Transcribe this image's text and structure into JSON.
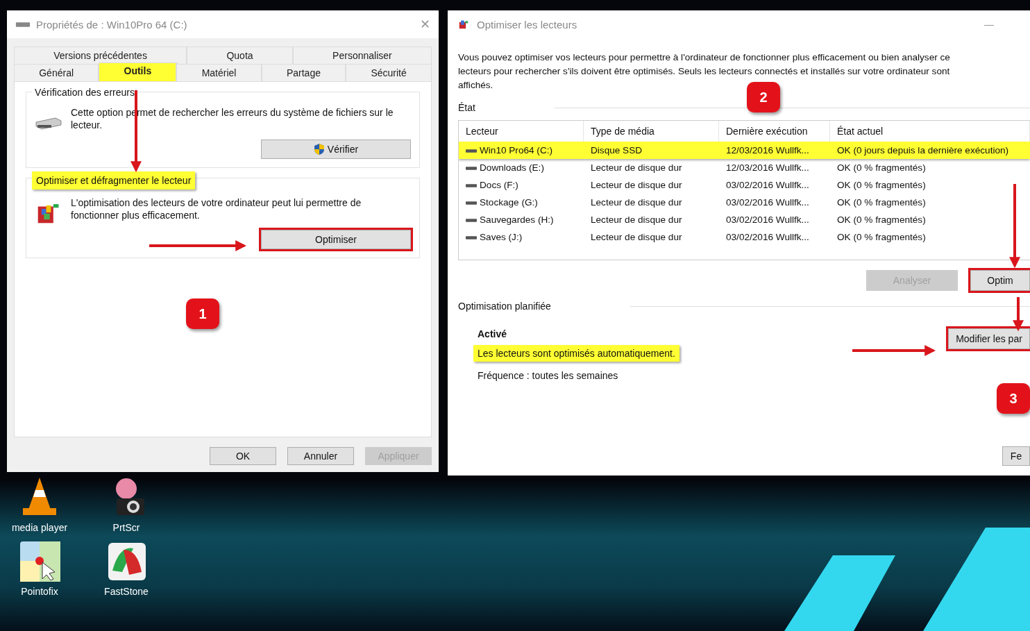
{
  "properties_window": {
    "title": "Propriétés de : Win10Pro 64 (C:)",
    "close": "✕",
    "tab_rows": [
      [
        {
          "label": "Versions précédentes",
          "selected": false,
          "highlighted": false
        },
        {
          "label": "Quota",
          "selected": false,
          "highlighted": false
        },
        {
          "label": "Personnaliser",
          "selected": false,
          "highlighted": false
        }
      ],
      [
        {
          "label": "Général",
          "selected": false,
          "highlighted": false
        },
        {
          "label": "Outils",
          "selected": true,
          "highlighted": true
        },
        {
          "label": "Matériel",
          "selected": false,
          "highlighted": false
        },
        {
          "label": "Partage",
          "selected": false,
          "highlighted": false
        },
        {
          "label": "Sécurité",
          "selected": false,
          "highlighted": false
        }
      ]
    ],
    "groups": [
      {
        "kind": "check",
        "title": "Vérification des erreurs",
        "highlighted": false,
        "text": "Cette option permet de rechercher les erreurs du système de fichiers sur le lecteur.",
        "button": {
          "label": "Vérifier",
          "boxed": false
        }
      },
      {
        "kind": "optimize",
        "title": "Optimiser et défragmenter le lecteur",
        "highlighted": true,
        "text": "L'optimisation des lecteurs de votre ordinateur peut lui permettre de fonctionner plus efficacement.",
        "button": {
          "label": "Optimiser",
          "boxed": true
        }
      }
    ],
    "buttons": [
      {
        "label": "OK",
        "disabled": false
      },
      {
        "label": "Annuler",
        "disabled": false
      },
      {
        "label": "Appliquer",
        "disabled": true
      }
    ]
  },
  "optimize_window": {
    "title": "Optimiser les lecteurs",
    "minimize": "—",
    "intro_lines": [
      "Vous pouvez optimiser vos lecteurs pour permettre à l'ordinateur de fonctionner plus efficacement ou bien analyser ce",
      "lecteurs pour rechercher s'ils doivent être optimisés. Seuls les lecteurs connectés et installés sur votre ordinateur sont",
      "affichés."
    ],
    "status_heading": "État",
    "table": {
      "columns": [
        "Lecteur",
        "Type de média",
        "Dernière exécution",
        "État actuel"
      ],
      "rows": [
        {
          "cells": [
            "Win10 Pro64 (C:)",
            "Disque SSD",
            "12/03/2016 Wullfk...",
            "OK (0 jours depuis la dernière exécution)"
          ],
          "highlighted": true
        },
        {
          "cells": [
            "Downloads (E:)",
            "Lecteur de disque dur",
            "12/03/2016 Wullfk...",
            "OK (0 % fragmentés)"
          ],
          "highlighted": false
        },
        {
          "cells": [
            "Docs (F:)",
            "Lecteur de disque dur",
            "03/02/2016 Wullfk...",
            "OK (0 % fragmentés)"
          ],
          "highlighted": false
        },
        {
          "cells": [
            "Stockage (G:)",
            "Lecteur de disque dur",
            "03/02/2016 Wullfk...",
            "OK (0 % fragmentés)"
          ],
          "highlighted": false
        },
        {
          "cells": [
            "Sauvegardes (H:)",
            "Lecteur de disque dur",
            "03/02/2016 Wullfk...",
            "OK (0 % fragmentés)"
          ],
          "highlighted": false
        },
        {
          "cells": [
            "Saves (J:)",
            "Lecteur de disque dur",
            "03/02/2016 Wullfk...",
            "OK (0 % fragmentés)"
          ],
          "highlighted": false
        }
      ]
    },
    "actions": [
      {
        "label": "Analyser",
        "disabled": true,
        "boxed": false
      },
      {
        "label": "Optim",
        "disabled": false,
        "boxed": true
      }
    ],
    "schedule_heading": "Optimisation planifiée",
    "schedule_state": "Activé",
    "schedule_lines": [
      {
        "text": "Les lecteurs sont optimisés automatiquement.",
        "highlighted": true
      },
      {
        "text": "Fréquence : toutes les semaines",
        "highlighted": false
      }
    ],
    "settings_button": {
      "label": "Modifier les par",
      "boxed": true
    },
    "close_button": "Fe"
  },
  "callouts": [
    "1",
    "2",
    "3"
  ],
  "desktop_icons": [
    {
      "kind": "cone",
      "label": "media player"
    },
    {
      "kind": "camera",
      "label": "PrtScr"
    },
    {
      "kind": "pointer",
      "label": "Pointofix"
    },
    {
      "kind": "viewer",
      "label": "FastStone"
    }
  ]
}
